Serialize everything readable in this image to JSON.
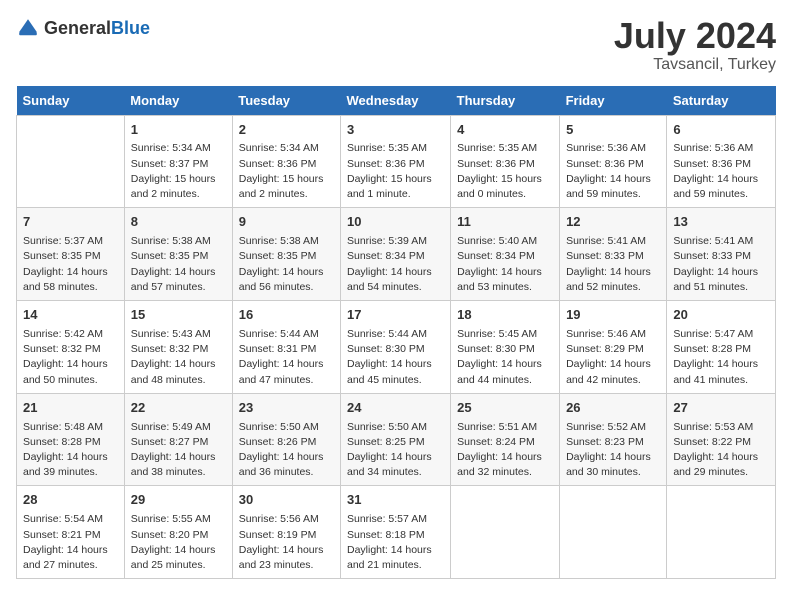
{
  "header": {
    "logo_general": "General",
    "logo_blue": "Blue",
    "month_year": "July 2024",
    "location": "Tavsancil, Turkey"
  },
  "columns": [
    "Sunday",
    "Monday",
    "Tuesday",
    "Wednesday",
    "Thursday",
    "Friday",
    "Saturday"
  ],
  "weeks": [
    [
      {
        "day": "",
        "sunrise": "",
        "sunset": "",
        "daylight": ""
      },
      {
        "day": "1",
        "sunrise": "Sunrise: 5:34 AM",
        "sunset": "Sunset: 8:37 PM",
        "daylight": "Daylight: 15 hours and 2 minutes."
      },
      {
        "day": "2",
        "sunrise": "Sunrise: 5:34 AM",
        "sunset": "Sunset: 8:36 PM",
        "daylight": "Daylight: 15 hours and 2 minutes."
      },
      {
        "day": "3",
        "sunrise": "Sunrise: 5:35 AM",
        "sunset": "Sunset: 8:36 PM",
        "daylight": "Daylight: 15 hours and 1 minute."
      },
      {
        "day": "4",
        "sunrise": "Sunrise: 5:35 AM",
        "sunset": "Sunset: 8:36 PM",
        "daylight": "Daylight: 15 hours and 0 minutes."
      },
      {
        "day": "5",
        "sunrise": "Sunrise: 5:36 AM",
        "sunset": "Sunset: 8:36 PM",
        "daylight": "Daylight: 14 hours and 59 minutes."
      },
      {
        "day": "6",
        "sunrise": "Sunrise: 5:36 AM",
        "sunset": "Sunset: 8:36 PM",
        "daylight": "Daylight: 14 hours and 59 minutes."
      }
    ],
    [
      {
        "day": "7",
        "sunrise": "Sunrise: 5:37 AM",
        "sunset": "Sunset: 8:35 PM",
        "daylight": "Daylight: 14 hours and 58 minutes."
      },
      {
        "day": "8",
        "sunrise": "Sunrise: 5:38 AM",
        "sunset": "Sunset: 8:35 PM",
        "daylight": "Daylight: 14 hours and 57 minutes."
      },
      {
        "day": "9",
        "sunrise": "Sunrise: 5:38 AM",
        "sunset": "Sunset: 8:35 PM",
        "daylight": "Daylight: 14 hours and 56 minutes."
      },
      {
        "day": "10",
        "sunrise": "Sunrise: 5:39 AM",
        "sunset": "Sunset: 8:34 PM",
        "daylight": "Daylight: 14 hours and 54 minutes."
      },
      {
        "day": "11",
        "sunrise": "Sunrise: 5:40 AM",
        "sunset": "Sunset: 8:34 PM",
        "daylight": "Daylight: 14 hours and 53 minutes."
      },
      {
        "day": "12",
        "sunrise": "Sunrise: 5:41 AM",
        "sunset": "Sunset: 8:33 PM",
        "daylight": "Daylight: 14 hours and 52 minutes."
      },
      {
        "day": "13",
        "sunrise": "Sunrise: 5:41 AM",
        "sunset": "Sunset: 8:33 PM",
        "daylight": "Daylight: 14 hours and 51 minutes."
      }
    ],
    [
      {
        "day": "14",
        "sunrise": "Sunrise: 5:42 AM",
        "sunset": "Sunset: 8:32 PM",
        "daylight": "Daylight: 14 hours and 50 minutes."
      },
      {
        "day": "15",
        "sunrise": "Sunrise: 5:43 AM",
        "sunset": "Sunset: 8:32 PM",
        "daylight": "Daylight: 14 hours and 48 minutes."
      },
      {
        "day": "16",
        "sunrise": "Sunrise: 5:44 AM",
        "sunset": "Sunset: 8:31 PM",
        "daylight": "Daylight: 14 hours and 47 minutes."
      },
      {
        "day": "17",
        "sunrise": "Sunrise: 5:44 AM",
        "sunset": "Sunset: 8:30 PM",
        "daylight": "Daylight: 14 hours and 45 minutes."
      },
      {
        "day": "18",
        "sunrise": "Sunrise: 5:45 AM",
        "sunset": "Sunset: 8:30 PM",
        "daylight": "Daylight: 14 hours and 44 minutes."
      },
      {
        "day": "19",
        "sunrise": "Sunrise: 5:46 AM",
        "sunset": "Sunset: 8:29 PM",
        "daylight": "Daylight: 14 hours and 42 minutes."
      },
      {
        "day": "20",
        "sunrise": "Sunrise: 5:47 AM",
        "sunset": "Sunset: 8:28 PM",
        "daylight": "Daylight: 14 hours and 41 minutes."
      }
    ],
    [
      {
        "day": "21",
        "sunrise": "Sunrise: 5:48 AM",
        "sunset": "Sunset: 8:28 PM",
        "daylight": "Daylight: 14 hours and 39 minutes."
      },
      {
        "day": "22",
        "sunrise": "Sunrise: 5:49 AM",
        "sunset": "Sunset: 8:27 PM",
        "daylight": "Daylight: 14 hours and 38 minutes."
      },
      {
        "day": "23",
        "sunrise": "Sunrise: 5:50 AM",
        "sunset": "Sunset: 8:26 PM",
        "daylight": "Daylight: 14 hours and 36 minutes."
      },
      {
        "day": "24",
        "sunrise": "Sunrise: 5:50 AM",
        "sunset": "Sunset: 8:25 PM",
        "daylight": "Daylight: 14 hours and 34 minutes."
      },
      {
        "day": "25",
        "sunrise": "Sunrise: 5:51 AM",
        "sunset": "Sunset: 8:24 PM",
        "daylight": "Daylight: 14 hours and 32 minutes."
      },
      {
        "day": "26",
        "sunrise": "Sunrise: 5:52 AM",
        "sunset": "Sunset: 8:23 PM",
        "daylight": "Daylight: 14 hours and 30 minutes."
      },
      {
        "day": "27",
        "sunrise": "Sunrise: 5:53 AM",
        "sunset": "Sunset: 8:22 PM",
        "daylight": "Daylight: 14 hours and 29 minutes."
      }
    ],
    [
      {
        "day": "28",
        "sunrise": "Sunrise: 5:54 AM",
        "sunset": "Sunset: 8:21 PM",
        "daylight": "Daylight: 14 hours and 27 minutes."
      },
      {
        "day": "29",
        "sunrise": "Sunrise: 5:55 AM",
        "sunset": "Sunset: 8:20 PM",
        "daylight": "Daylight: 14 hours and 25 minutes."
      },
      {
        "day": "30",
        "sunrise": "Sunrise: 5:56 AM",
        "sunset": "Sunset: 8:19 PM",
        "daylight": "Daylight: 14 hours and 23 minutes."
      },
      {
        "day": "31",
        "sunrise": "Sunrise: 5:57 AM",
        "sunset": "Sunset: 8:18 PM",
        "daylight": "Daylight: 14 hours and 21 minutes."
      },
      {
        "day": "",
        "sunrise": "",
        "sunset": "",
        "daylight": ""
      },
      {
        "day": "",
        "sunrise": "",
        "sunset": "",
        "daylight": ""
      },
      {
        "day": "",
        "sunrise": "",
        "sunset": "",
        "daylight": ""
      }
    ]
  ]
}
